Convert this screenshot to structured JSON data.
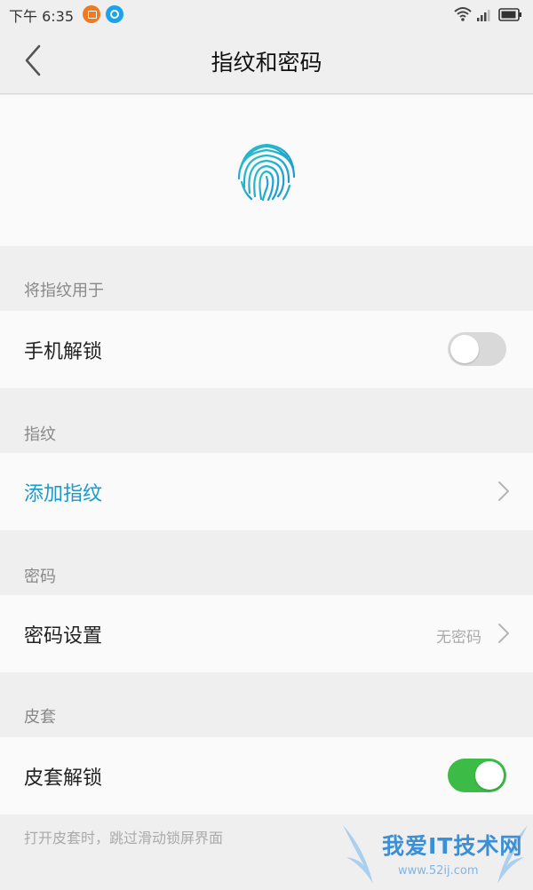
{
  "status_bar": {
    "time": "下午 6:35",
    "icons": [
      "app-orange-icon",
      "app-blue-icon",
      "wifi-icon",
      "signal-icon",
      "battery-icon"
    ]
  },
  "header": {
    "title": "指纹和密码",
    "back_icon": "chevron-left-icon"
  },
  "hero": {
    "icon": "fingerprint-icon",
    "color": "#1fb3c9"
  },
  "sections": {
    "use_fingerprint": {
      "header": "将指纹用于",
      "row_label": "手机解锁",
      "toggle_on": false
    },
    "fingerprint": {
      "header": "指纹",
      "row_label": "添加指纹"
    },
    "password": {
      "header": "密码",
      "row_label": "密码设置",
      "row_value": "无密码"
    },
    "cover": {
      "header": "皮套",
      "row_label": "皮套解锁",
      "toggle_on": true,
      "note": "打开皮套时，跳过滑动锁屏界面"
    }
  },
  "colors": {
    "accent": "#1a9bd0",
    "toggle_on": "#3dbb47",
    "toggle_off": "#d9d9d9"
  },
  "watermark": {
    "text": "我爱IT技术网",
    "url": "www.52ij.com"
  }
}
